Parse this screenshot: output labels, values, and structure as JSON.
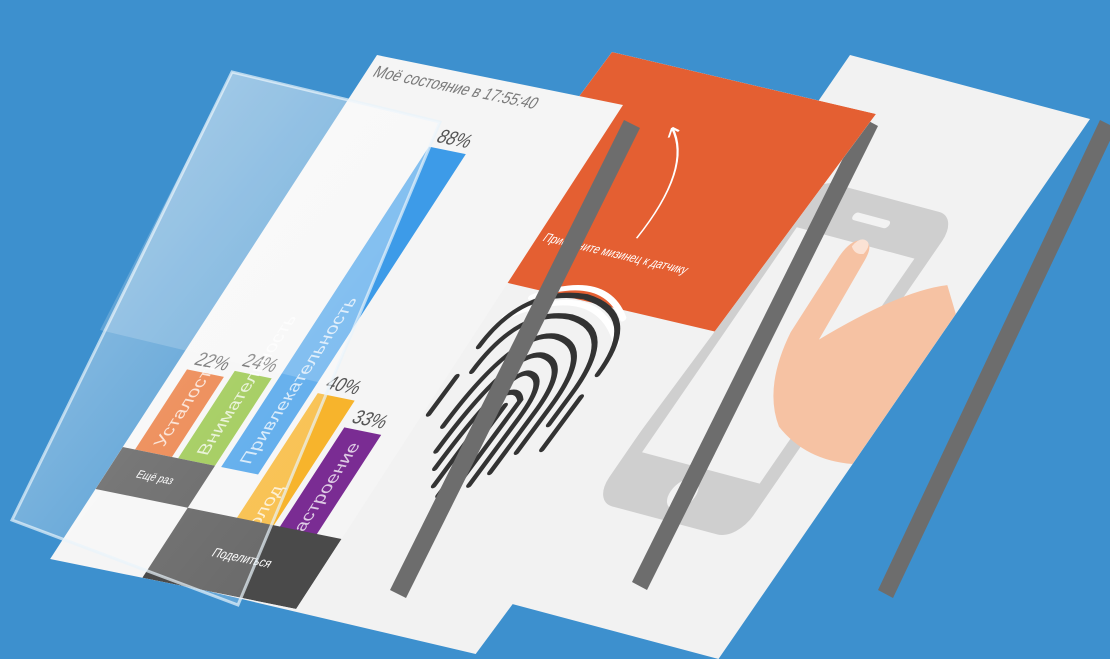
{
  "results_screen": {
    "title": "Моё состояние в 17:55:40",
    "again_button": "Ещё раз",
    "share_button": "Поделиться"
  },
  "chart_data": {
    "type": "bar",
    "categories": [
      "Усталость",
      "Внимательность",
      "Привлекательность",
      "Голод",
      "Настроение"
    ],
    "values": [
      22,
      24,
      88,
      40,
      33
    ],
    "value_labels": [
      "22%",
      "24%",
      "88%",
      "40%",
      "33%"
    ],
    "colors": [
      "#e96f2d",
      "#8fc13a",
      "#3d9be8",
      "#f7b42c",
      "#7a2c93"
    ],
    "ylim": [
      0,
      100
    ]
  },
  "fingerprint_screen": {
    "instruction": "Прислоните мизинец к датчику",
    "accent_color": "#e45f32",
    "icon": "fingerprint-icon"
  },
  "hand_screen": {
    "icon": "hand-phone-icon"
  }
}
